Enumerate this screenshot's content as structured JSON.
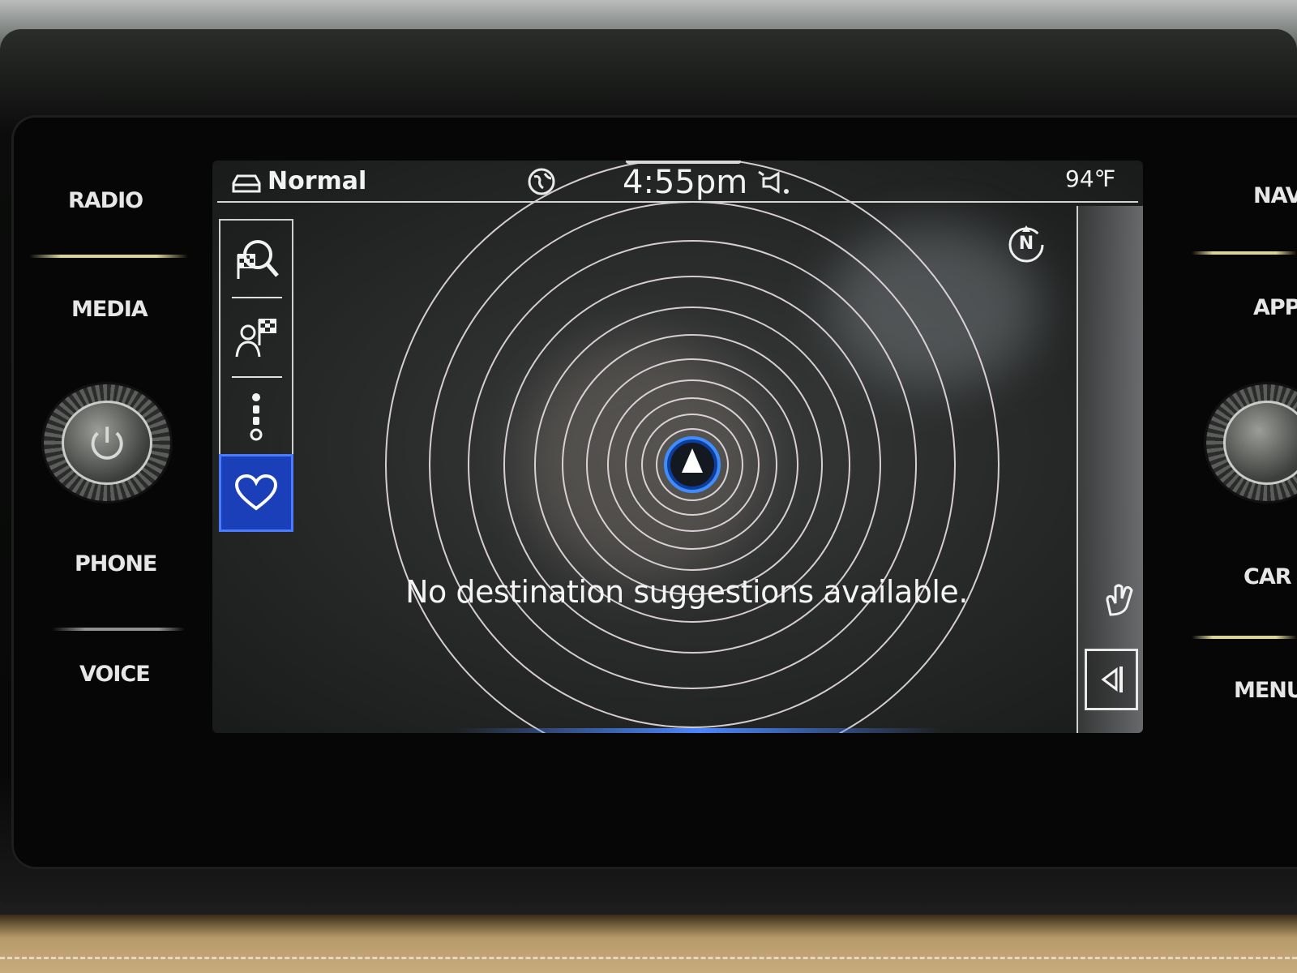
{
  "hardware_buttons": {
    "left": [
      "RADIO",
      "MEDIA",
      "PHONE",
      "VOICE"
    ],
    "right": [
      "NAV",
      "APP",
      "CAR",
      "MENU"
    ]
  },
  "status_bar": {
    "drive_mode": "Normal",
    "time": "4:55pm",
    "temperature": "94℉"
  },
  "map": {
    "message": "No destination suggestions available.",
    "compass_label": "N"
  },
  "sidebar": {
    "items": [
      {
        "icon": "destination-search-icon",
        "active": false
      },
      {
        "icon": "contact-destination-icon",
        "active": false
      },
      {
        "icon": "route-stops-icon",
        "active": false
      },
      {
        "icon": "favorites-heart-icon",
        "active": true
      }
    ]
  },
  "colors": {
    "active_blue": "#1a3fb8",
    "accent_line": "#d9d49a"
  }
}
